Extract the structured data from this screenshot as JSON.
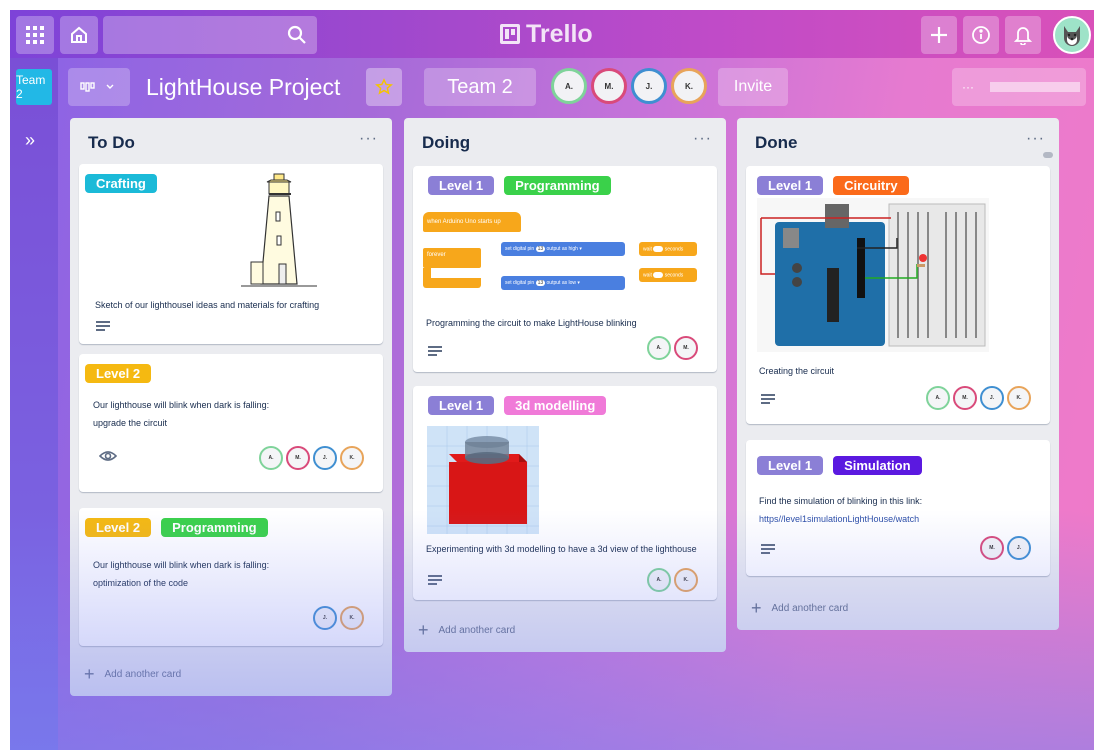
{
  "app": {
    "logo_text": "Trello"
  },
  "topbar": {
    "search_placeholder": ""
  },
  "sidebar": {
    "team_badge": "Team 2",
    "expand": "»"
  },
  "board": {
    "title": "LightHouse Project",
    "team_button": "Team 2",
    "invite_label": "Invite",
    "menu_label": "···",
    "members": [
      "A.",
      "M.",
      "J.",
      "K."
    ]
  },
  "lists": [
    {
      "title": "To Do",
      "menu": "···",
      "add_card": "Add another card",
      "cards": [
        {
          "labels": [
            "Crafting"
          ],
          "text": "Sketch of our lighthousel ideas and materials for crafting"
        },
        {
          "labels": [
            "Level 2"
          ],
          "text_lines": [
            "Our lighthouse will blink when dark is falling:",
            "upgrade the circuit"
          ],
          "members": [
            "A.",
            "M.",
            "J.",
            "K."
          ]
        },
        {
          "labels": [
            "Level 2",
            "Programming"
          ],
          "text_lines": [
            "Our lighthouse will blink when dark is falling:",
            "optimization of the code"
          ],
          "members": [
            "J.",
            "K."
          ]
        }
      ]
    },
    {
      "title": "Doing",
      "menu": "···",
      "add_card": "Add another card",
      "cards": [
        {
          "labels": [
            "Level 1",
            "Programming"
          ],
          "text": "Programming the circuit to make LightHouse blinking",
          "members": [
            "A.",
            "M."
          ],
          "blocks": {
            "start": "when Arduino Uno starts up",
            "forever": "forever",
            "pin_text": "set digital pin",
            "pin": "13",
            "output_as": "output as",
            "high": "high ▾",
            "low": "low ▾",
            "wait": "wait",
            "seconds": "seconds"
          }
        },
        {
          "labels": [
            "Level 1",
            "3d modelling"
          ],
          "text": "Experimenting with 3d modelling to have a 3d view of the lighthouse",
          "members": [
            "A.",
            "K."
          ]
        }
      ]
    },
    {
      "title": "Done",
      "menu": "···",
      "add_card": "Add another card",
      "cards": [
        {
          "labels": [
            "Level 1",
            "Circuitry"
          ],
          "text": "Creating the circuit",
          "members": [
            "A.",
            "M.",
            "J.",
            "K."
          ]
        },
        {
          "labels": [
            "Level 1",
            "Simulation"
          ],
          "text": "Find the simulation of blinking in this link:",
          "link": "https//level1simulationLightHouse/watch",
          "members": [
            "M.",
            "J."
          ]
        }
      ]
    }
  ],
  "colors": {
    "member_a": "#7fd39a",
    "member_m": "#d94a7a",
    "member_j": "#3f8fd1",
    "member_k": "#e8a45a"
  }
}
